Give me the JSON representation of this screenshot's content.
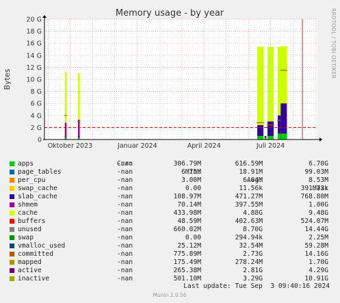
{
  "title": "Memory usage - by year",
  "ylabel": "Bytes",
  "side_text": "RRDTOOL / TOBI OETIKER",
  "footer": "Munin 2.0.56",
  "last_update": "Last update: Tue Sep  3 09:40:16 2024",
  "legend_headers": {
    "cur": "Cur:",
    "min": "Min:",
    "avg": "Avg:",
    "max": "Max:"
  },
  "legend": [
    {
      "name": "apps",
      "color": "#00cc00",
      "cur": "-nan",
      "min": "306.79M",
      "avg": "616.59M",
      "max": "6.70G"
    },
    {
      "name": "page_tables",
      "color": "#0066b3",
      "cur": "-nan",
      "min": "6.75M",
      "avg": "18.91M",
      "max": "99.03M"
    },
    {
      "name": "per_cpu",
      "color": "#ff8000",
      "cur": "-nan",
      "min": "3.00M",
      "avg": "6.64M",
      "max": "8.53M"
    },
    {
      "name": "swap_cache",
      "color": "#ffcc00",
      "cur": "-nan",
      "min": "0.00",
      "avg": "11.56k",
      "max": "391.73k"
    },
    {
      "name": "slab_cache",
      "color": "#330099",
      "cur": "-nan",
      "min": "108.97M",
      "avg": "471.27M",
      "max": "768.80M"
    },
    {
      "name": "shmem",
      "color": "#990099",
      "cur": "-nan",
      "min": "70.14M",
      "avg": "397.55M",
      "max": "1.00G"
    },
    {
      "name": "cache",
      "color": "#ccff00",
      "cur": "-nan",
      "min": "433.98M",
      "avg": "4.88G",
      "max": "9.48G"
    },
    {
      "name": "buffers",
      "color": "#ff0000",
      "cur": "-nan",
      "min": "48.59M",
      "avg": "402.63M",
      "max": "524.07M"
    },
    {
      "name": "unused",
      "color": "#808080",
      "cur": "-nan",
      "min": "660.02M",
      "avg": "8.70G",
      "max": "14.44G"
    },
    {
      "name": "swap",
      "color": "#008f00",
      "cur": "-nan",
      "min": "0.00",
      "avg": "294.94k",
      "max": "2.25M"
    },
    {
      "name": "vmalloc_used",
      "color": "#00487d",
      "cur": "-nan",
      "min": "25.12M",
      "avg": "32.54M",
      "max": "59.28M"
    },
    {
      "name": "committed",
      "color": "#b35a00",
      "cur": "-nan",
      "min": "775.89M",
      "avg": "2.73G",
      "max": "14.16G"
    },
    {
      "name": "mapped",
      "color": "#b38f00",
      "cur": "-nan",
      "min": "175.49M",
      "avg": "278.24M",
      "max": "1.70G"
    },
    {
      "name": "active",
      "color": "#6b006b",
      "cur": "-nan",
      "min": "265.38M",
      "avg": "2.81G",
      "max": "4.29G"
    },
    {
      "name": "inactive",
      "color": "#8fb300",
      "cur": "-nan",
      "min": "501.10M",
      "avg": "3.29G",
      "max": "10.91G"
    }
  ],
  "chart_data": {
    "type": "area",
    "title": "Memory usage - by year",
    "ylabel": "Bytes",
    "y_ticks": [
      "0",
      "2 G",
      "4 G",
      "6 G",
      "8 G",
      "10 G",
      "12 G",
      "14 G",
      "16 G",
      "18 G",
      "20 G"
    ],
    "ylim": [
      0,
      20
    ],
    "y_unit": "G",
    "x_ticks": [
      "Oktober 2023",
      "Januar 2024",
      "April 2024",
      "Juli 2024"
    ],
    "xlim": [
      "2023-08-27",
      "2024-09-03"
    ],
    "x_tick_dates": [
      "2023-10-01",
      "2024-01-01",
      "2024-04-01",
      "2024-07-01"
    ],
    "grid": true,
    "colors": {
      "background": "#ffffff",
      "grid_major": "#e8a0a0",
      "grid_minor": "#dcdcdc",
      "frame": "#000000",
      "threshold": "#cc0000"
    },
    "threshold": 2,
    "bursts": [
      {
        "date": "2023-09-25",
        "values": {
          "apps": 0.3,
          "slab_cache": 0.3,
          "shmem": 2.8,
          "cache": 11.2,
          "committed": 4.0
        }
      },
      {
        "date": "2023-10-13",
        "values": {
          "apps": 0.3,
          "slab_cache": 0.6,
          "shmem": 3.3,
          "cache": 11.0,
          "committed": 3.0
        }
      },
      {
        "date": "2024-06-17",
        "values": {
          "apps": 0.6,
          "slab_cache": 2.4,
          "cache": 15.4,
          "committed": 2.8
        }
      },
      {
        "date": "2024-06-24",
        "values": {
          "apps": 0.3,
          "slab_cache": 0.6,
          "shmem": 0.3,
          "committed": 2.0
        }
      },
      {
        "date": "2024-07-01",
        "values": {
          "apps": 0.6,
          "slab_cache": 3.0,
          "shmem": 1.8,
          "cache": 15.4,
          "committed": 2.4
        }
      },
      {
        "date": "2024-07-15",
        "values": {
          "apps": 1.0,
          "slab_cache": 4.0,
          "shmem": 3.0,
          "cache": 15.4,
          "committed": 3.2
        }
      },
      {
        "date": "2024-07-19",
        "values": {
          "apps": 1.0,
          "slab_cache": 6.0,
          "shmem": 3.4,
          "cache": 15.5,
          "committed": 11.5
        }
      }
    ]
  }
}
